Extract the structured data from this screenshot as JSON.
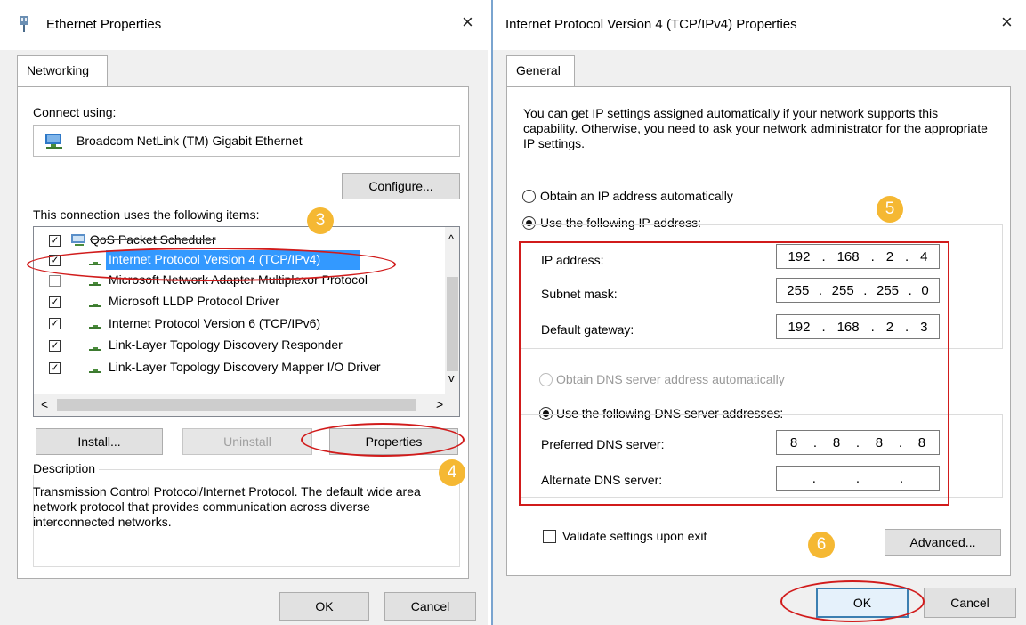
{
  "left": {
    "title": "Ethernet Properties",
    "close_icon": "×",
    "tab": "Networking",
    "connect_using_label": "Connect using:",
    "adapter_name": "Broadcom NetLink (TM) Gigabit Ethernet",
    "configure_button": "Configure...",
    "items_label": "This connection uses the following items:",
    "items": [
      {
        "label": "QoS Packet Scheduler",
        "checked": true
      },
      {
        "label": "Internet Protocol Version 4 (TCP/IPv4)",
        "checked": true,
        "selected": true
      },
      {
        "label": "Microsoft Network Adapter Multiplexor Protocol",
        "checked": false
      },
      {
        "label": "Microsoft LLDP Protocol Driver",
        "checked": true
      },
      {
        "label": "Internet Protocol Version 6 (TCP/IPv6)",
        "checked": true
      },
      {
        "label": "Link-Layer Topology Discovery Responder",
        "checked": true
      },
      {
        "label": "Link-Layer Topology Discovery Mapper I/O Driver",
        "checked": true
      }
    ],
    "scroll_up": "^",
    "scroll_down": "v",
    "scroll_left": "<",
    "scroll_right": ">",
    "install_button": "Install...",
    "uninstall_button": "Uninstall",
    "properties_button": "Properties",
    "description_label": "Description",
    "description_text": "Transmission Control Protocol/Internet Protocol. The default wide area network protocol that provides communication across diverse interconnected networks.",
    "ok_button": "OK",
    "cancel_button": "Cancel"
  },
  "right": {
    "title": "Internet Protocol Version 4 (TCP/IPv4) Properties",
    "close_icon": "×",
    "tab": "General",
    "info_text": "You can get IP settings assigned automatically if your network supports this capability. Otherwise, you need to ask your network administrator for the appropriate IP settings.",
    "radio_auto_ip": "Obtain an IP address automatically",
    "radio_manual_ip": "Use the following IP address:",
    "ip_label": "IP address:",
    "ip_value": [
      "192",
      "168",
      "2",
      "4"
    ],
    "subnet_label": "Subnet mask:",
    "subnet_value": [
      "255",
      "255",
      "255",
      "0"
    ],
    "gateway_label": "Default gateway:",
    "gateway_value": [
      "192",
      "168",
      "2",
      "3"
    ],
    "radio_auto_dns": "Obtain DNS server address automatically",
    "radio_manual_dns": "Use the following DNS server addresses:",
    "preferred_dns_label": "Preferred DNS server:",
    "preferred_dns_value": [
      "8",
      "8",
      "8",
      "8"
    ],
    "alternate_dns_label": "Alternate DNS server:",
    "alternate_dns_value": [
      "",
      "",
      "",
      ""
    ],
    "ip_dot": ".",
    "validate_label": "Validate settings upon exit",
    "advanced_button": "Advanced...",
    "ok_button": "OK",
    "cancel_button": "Cancel"
  },
  "steps": {
    "s3": "3",
    "s4": "4",
    "s5": "5",
    "s6": "6"
  },
  "colors": {
    "annotation_red": "#d11b1b",
    "badge_orange": "#f5b833",
    "selection_blue": "#3399ff"
  }
}
